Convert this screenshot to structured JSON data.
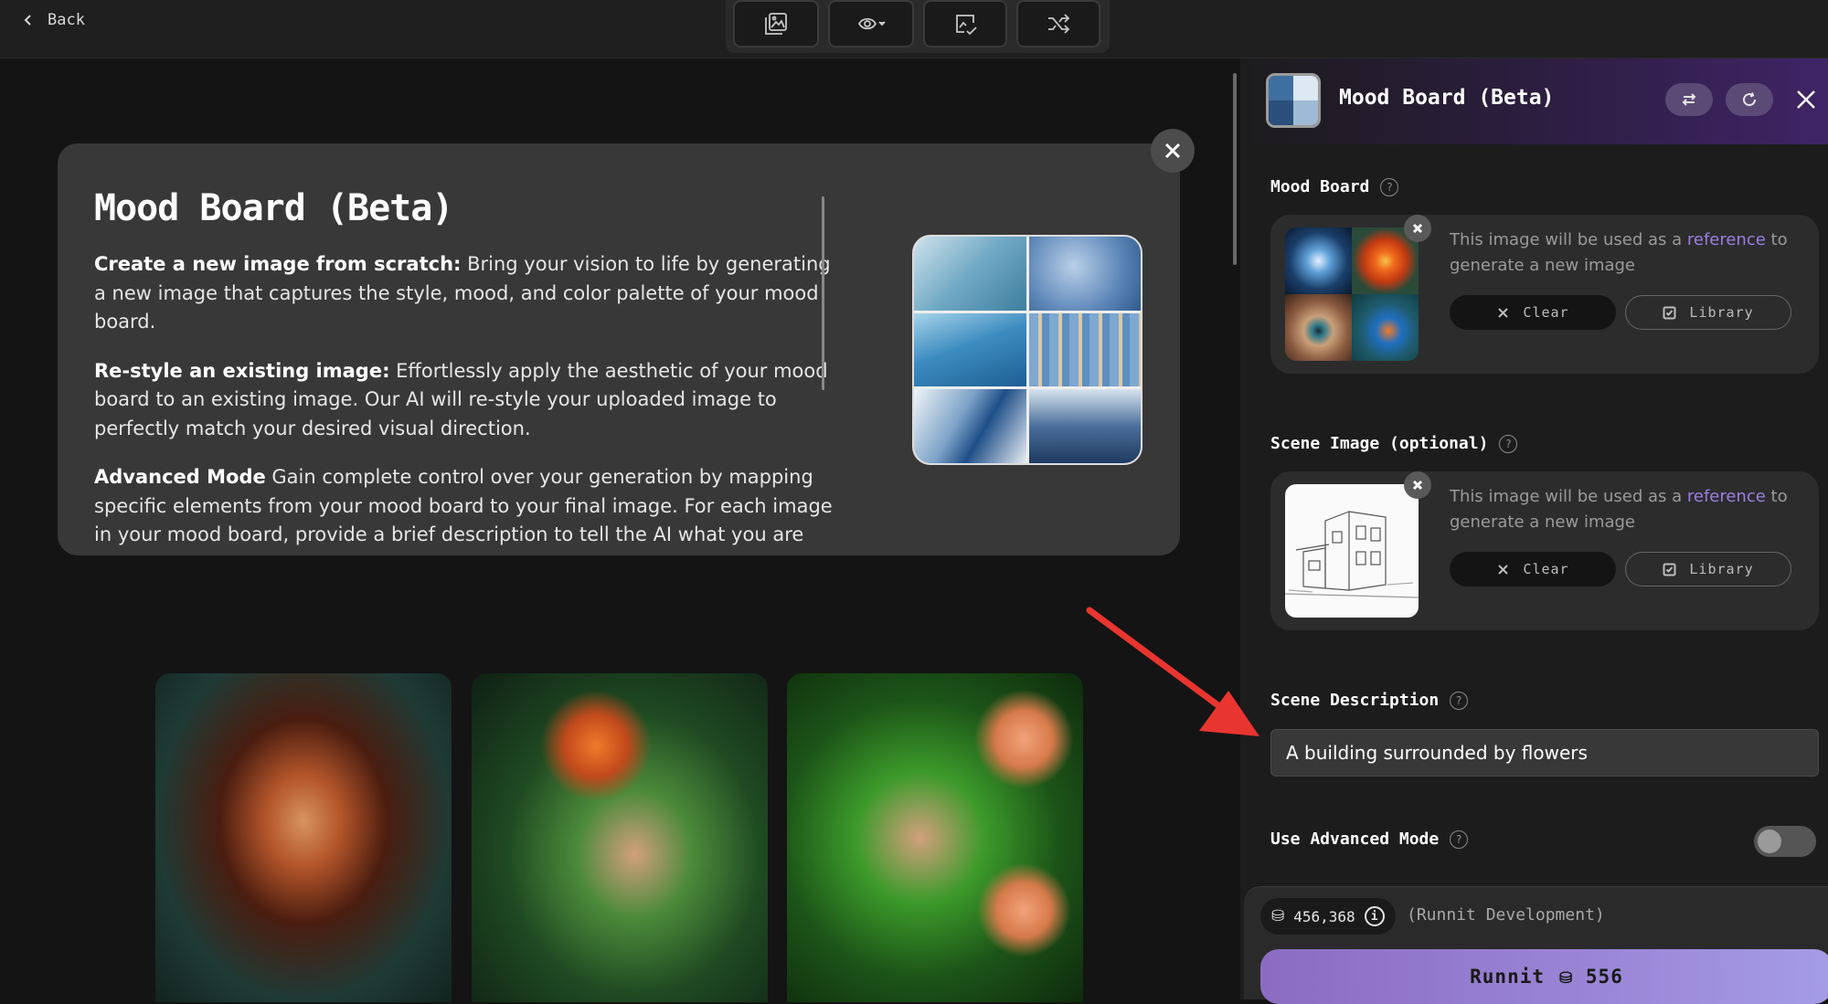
{
  "topbar": {
    "back_label": "Back",
    "tools": [
      "gallery-icon",
      "eye-dropdown-icon",
      "image-check-icon",
      "shuffle-icon"
    ]
  },
  "info": {
    "title": "Mood Board (Beta)",
    "p1_bold": "Create a new image from scratch:",
    "p1_text": " Bring your vision to life by generating a new image that captures the style, mood, and color palette of your mood board.",
    "p2_bold": "Re-style an existing image:",
    "p2_text": " Effortlessly apply the aesthetic of your mood board to an existing image. Our AI will re-style your uploaded image to perfectly match your desired visual direction.",
    "p3_bold": "Advanced Mode",
    "p3_text": " Gain complete control over your generation by mapping specific elements from your mood board to your final image. For each image in your mood board, provide a brief description to tell the AI what you are"
  },
  "panel": {
    "title": "Mood Board (Beta)",
    "mood_board_label": "Mood Board",
    "scene_image_label": "Scene Image (optional)",
    "scene_description_label": "Scene Description",
    "scene_description_value": "A building surrounded by flowers",
    "advanced_mode_label": "Use Advanced Mode",
    "advanced_mode_on": false,
    "ref_text_before": "This image will be used as a ",
    "ref_text_link": "reference",
    "ref_text_after": " to generate a new image",
    "clear_label": "Clear",
    "library_label": "Library",
    "help_glyph": "?"
  },
  "footer": {
    "credits": "456,368",
    "info_glyph": "i",
    "dev_label": "(Runnit Development)",
    "run_label": "Runnit",
    "run_cost": "556"
  },
  "colors": {
    "accent": "#9b7fe0",
    "run_gradient_start": "#8b6cc2",
    "run_gradient_end": "#a59ce6",
    "arrow": "#e8352f"
  }
}
